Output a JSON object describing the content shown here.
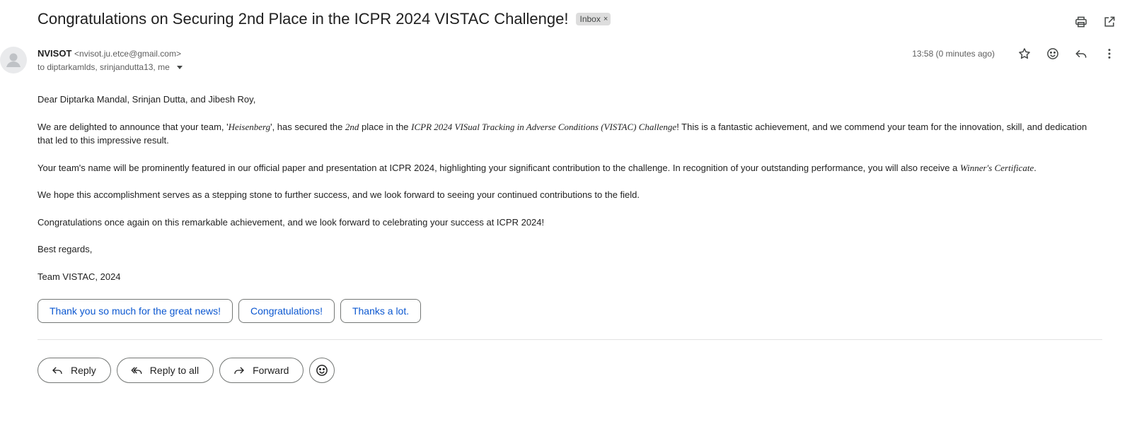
{
  "email": {
    "subject": "Congratulations on Securing 2nd Place in the ICPR 2024 VISTAC Challenge!",
    "label": "Inbox",
    "label_close": "×",
    "sender_name": "NVISOT",
    "sender_email": "<nvisot.ju.etce@gmail.com>",
    "recipients": "to diptarkamlds, srinjandutta13, me",
    "timestamp": "13:58 (0 minutes ago)"
  },
  "body": {
    "greeting": "Dear Diptarka Mandal, Srinjan Dutta, and Jibesh Roy,",
    "p1_a": "We are delighted to announce that your team, '",
    "p1_team": "Heisenberg",
    "p1_b": "', has secured the ",
    "p1_place": "2nd",
    "p1_c": " place in the ",
    "p1_challenge": "ICPR 2024 VISual Tracking in Adverse Conditions (VISTAC) Challenge",
    "p1_d": "! This is a fantastic achievement, and we commend your team for the innovation, skill, and dedication that led to this impressive result.",
    "p2_a": "Your team's name will be prominently featured in our official paper and presentation at ICPR 2024, highlighting your significant contribution to the challenge. In recognition of your outstanding performance, you will also receive a ",
    "p2_cert": "Winner's Certificate",
    "p2_b": ".",
    "p3": "We hope this accomplishment serves as a stepping stone to further success, and we look forward to seeing your continued contributions to the field.",
    "p4": "Congratulations once again on this remarkable achievement, and we look forward to celebrating your success at ICPR 2024!",
    "closing": "Best regards,",
    "signature": "Team VISTAC, 2024"
  },
  "smart_replies": [
    "Thank you so much for the great news!",
    "Congratulations!",
    "Thanks a lot."
  ],
  "actions": {
    "reply": "Reply",
    "reply_all": "Reply to all",
    "forward": "Forward"
  },
  "colors": {
    "link_blue": "#0b57d0",
    "chip_bg": "#dddddd",
    "border": "#747775"
  }
}
